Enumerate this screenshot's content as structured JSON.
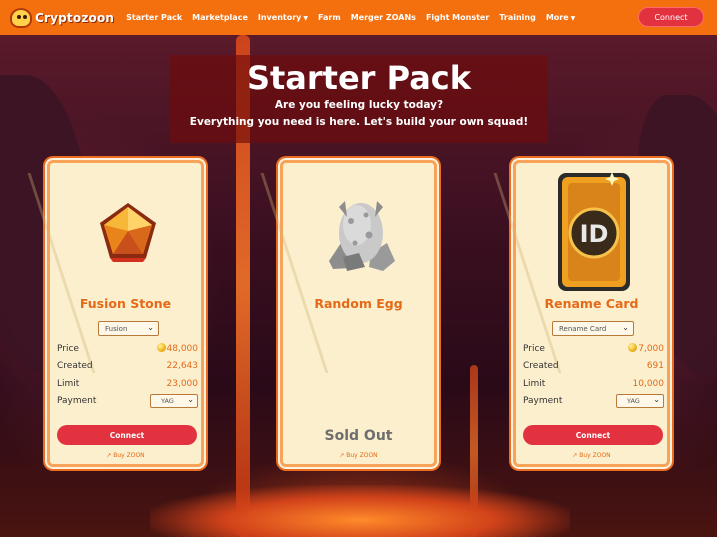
{
  "nav": {
    "logo_text": "Cryptozoon",
    "links": [
      "Starter Pack",
      "Marketplace",
      "Inventory",
      "Farm",
      "Merger ZOANs",
      "Fight Monster",
      "Training",
      "More"
    ],
    "connect_label": "Connect"
  },
  "hero": {
    "title": "Starter Pack",
    "line1": "Are you feeling lucky today?",
    "line2": "Everything you need is here. Let's build your own squad!"
  },
  "cards": [
    {
      "name": "Fusion Stone",
      "select_value": "Fusion",
      "price_label": "Price",
      "price": "48,000",
      "created_label": "Created",
      "created": "22,643",
      "limit_label": "Limit",
      "limit": "23,000",
      "payment_label": "Payment",
      "payment": "YAG",
      "button": "Connect",
      "buy_link": "Buy ZOON"
    },
    {
      "name": "Random Egg",
      "status": "Sold Out",
      "buy_link": "Buy ZOON"
    },
    {
      "name": "Rename Card",
      "select_value": "Rename Card",
      "price_label": "Price",
      "price": "7,000",
      "created_label": "Created",
      "created": "691",
      "limit_label": "Limit",
      "limit": "10,000",
      "payment_label": "Payment",
      "payment": "YAG",
      "button": "Connect",
      "buy_link": "Buy ZOON"
    }
  ],
  "colors": {
    "navbar": "#f4700e",
    "accent_button": "#e2323f",
    "card_text": "#e56a18"
  },
  "icons": [
    "cryptozoon-logo-icon",
    "chevron-down-icon",
    "gold-coin-icon",
    "external-link-icon"
  ]
}
